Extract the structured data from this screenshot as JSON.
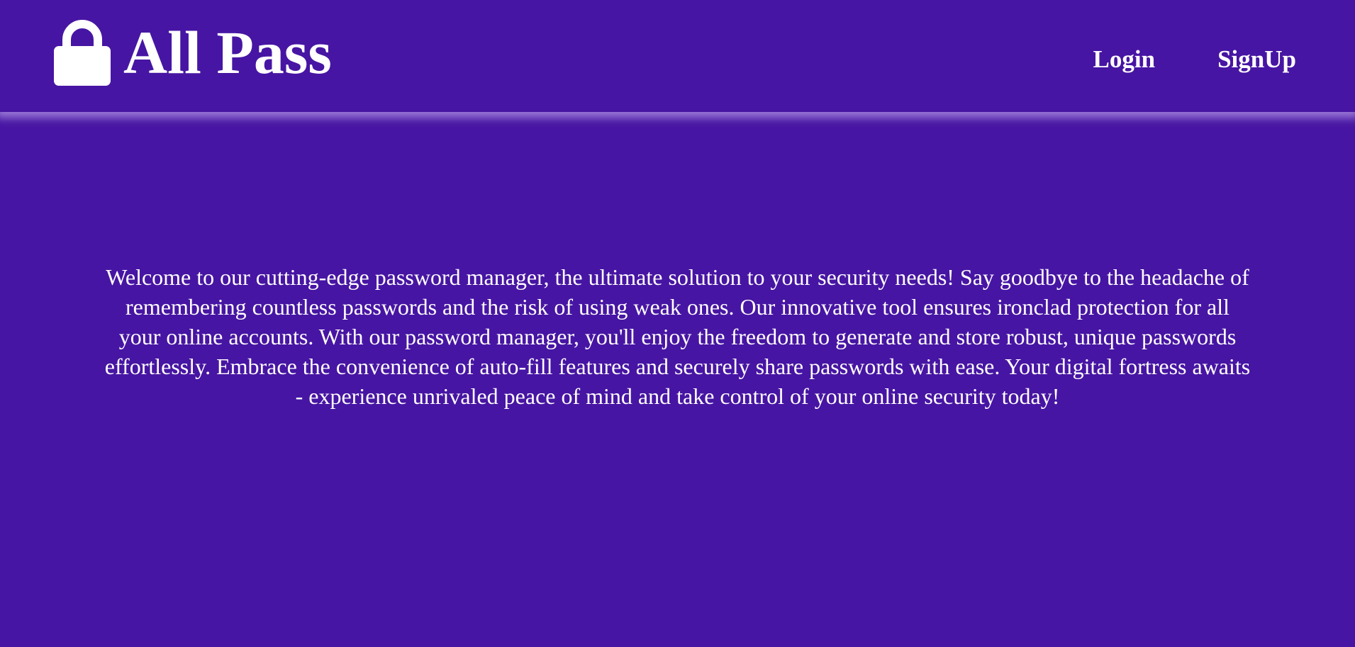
{
  "header": {
    "brand": {
      "icon": "lock-icon",
      "title": "All Pass"
    },
    "nav": {
      "login_label": "Login",
      "signup_label": "SignUp"
    }
  },
  "main": {
    "intro_text": "Welcome to our cutting-edge password manager, the ultimate solution to your security needs! Say goodbye to the headache of remembering countless passwords and the risk of using weak ones. Our innovative tool ensures ironclad protection for all your online accounts. With our password manager, you'll enjoy the freedom to generate and store robust, unique passwords effortlessly. Embrace the convenience of auto-fill features and securely share passwords with ease. Your digital fortress awaits - experience unrivaled peace of mind and take control of your online security today!"
  },
  "colors": {
    "background": "#4715a3",
    "text": "#ffffff",
    "header_glow": "#aa8ce1"
  }
}
